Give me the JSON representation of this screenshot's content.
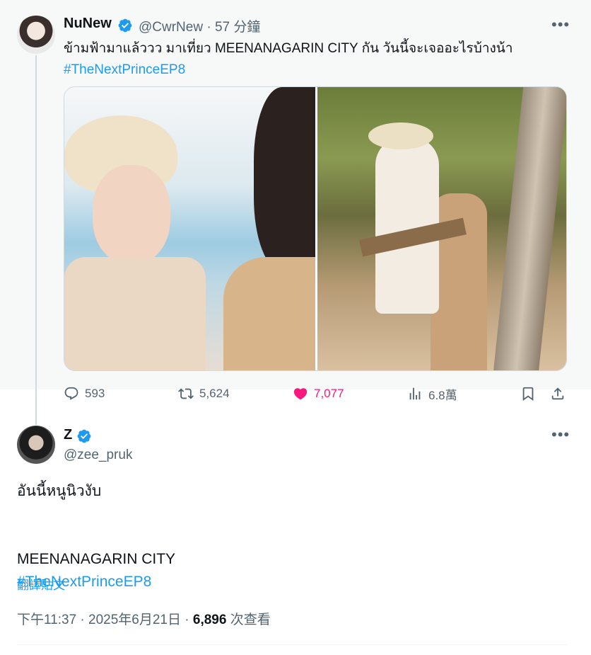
{
  "quoted_tweet": {
    "author_name": "NuNew",
    "handle": "@CwrNew",
    "separator": "·",
    "time": "57 分鐘",
    "text": "ข้ามฟ้ามาแล้ววว มาเที่ยว MEENANAGARIN CITY กัน วันนี้จะเจออะไรบ้างน้า",
    "hashtag": "#TheNextPrinceEP8",
    "more_label": "•••",
    "stats": {
      "replies": "593",
      "retweets": "5,624",
      "likes": "7,077",
      "views": "6.8萬"
    }
  },
  "main_tweet": {
    "author_name": "Z",
    "handle": "@zee_pruk",
    "more_label": "•••",
    "lines": [
      "อันนี้หนูนิวงับ",
      "",
      "MEENANAGARIN CITY"
    ],
    "hashtag": "#TheNextPrinceEP8",
    "translate_label": "翻譯貼文",
    "timestamp": "下午11:37 · 2025年6月21日 ·",
    "view_count": "6,896",
    "view_label": "次查看"
  },
  "colors": {
    "accent": "#1d9bf0",
    "like": "#f91880",
    "muted": "#536471",
    "text": "#0f1419",
    "quoted_bg": "#f7f9f9"
  },
  "icons": {
    "verified": "verified-badge-icon",
    "reply": "reply-icon",
    "retweet": "retweet-icon",
    "like": "heart-icon",
    "views": "views-icon",
    "bookmark": "bookmark-icon",
    "share": "share-icon",
    "more": "more-icon"
  }
}
